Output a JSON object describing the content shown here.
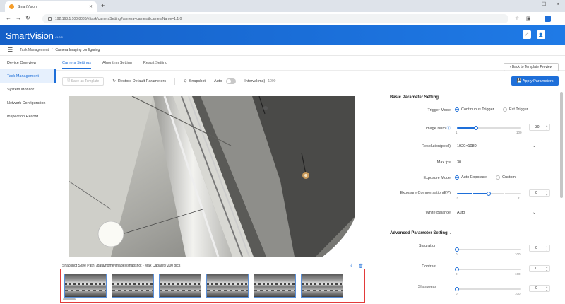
{
  "browser": {
    "tab_title": "SmartVision",
    "url": "192.168.1.100:8080/#/task/cameraSetting?camera=camera&cameraName=1.1.0",
    "new_tab": "+"
  },
  "app": {
    "brand": "SmartVision",
    "version": "v1.0.0",
    "header_icons": [
      "expand-icon",
      "user-icon"
    ]
  },
  "breadcrumb": [
    "Task Management",
    "Camera Imaging configuring"
  ],
  "sidebar": {
    "items": [
      {
        "label": "Device Overview",
        "active": false
      },
      {
        "label": "Task Management",
        "active": true
      },
      {
        "label": "System Monitor",
        "active": false
      },
      {
        "label": "Network Configuration",
        "active": false
      },
      {
        "label": "Inspection Record",
        "active": false
      }
    ]
  },
  "tabs": [
    {
      "label": "Camera Settings",
      "active": true
    },
    {
      "label": "Algorithm Setting",
      "active": false
    },
    {
      "label": "Result Setting",
      "active": false
    }
  ],
  "actions": {
    "back": "Back to Template Preview",
    "apply": "Apply Parameters"
  },
  "toolbar": {
    "save_template": "Save as Template",
    "restore": "Restore Default Parameters",
    "snapshot": "Snapshot",
    "auto": "Auto",
    "interval_label": "Interval(ms)",
    "interval_value": "1000"
  },
  "viewer": {
    "save_path": "Snapshot Save Path: /data/home/images/snapshot - Max Capacity 200 pics"
  },
  "basic": {
    "title": "Basic Parameter Setting",
    "trigger_mode_label": "Trigger Mode",
    "trigger_options": [
      "Continuous Trigger",
      "Ext Trigger"
    ],
    "trigger_selected": 0,
    "image_num_label": "Image Num",
    "image_num_value": "30",
    "image_num_fraction": 0.3,
    "image_num_min": "1",
    "image_num_max": "100",
    "resolution_label": "Resolution(pixel)",
    "resolution_value": "1920×1080",
    "max_fps_label": "Max fps",
    "max_fps_value": "30",
    "exposure_mode_label": "Exposure Mode",
    "exposure_options": [
      "Auto Exposure",
      "Custom"
    ],
    "exposure_selected": 0,
    "exposure_comp_label": "Exposure Compensation(EV)",
    "exposure_comp_value": "0",
    "exposure_comp_fraction": 0.5,
    "exposure_comp_min": "-2",
    "exposure_comp_max": "2",
    "wb_label": "White Balance",
    "wb_value": "Auto"
  },
  "advanced": {
    "title": "Advanced Parameter Setting",
    "sliders": [
      {
        "label": "Saturation",
        "value": "0",
        "min": "0",
        "max": "100",
        "fraction": 0
      },
      {
        "label": "Contrast",
        "value": "0",
        "min": "0",
        "max": "100",
        "fraction": 0
      },
      {
        "label": "Sharpness",
        "value": "0",
        "min": "0",
        "max": "100",
        "fraction": 0
      }
    ]
  },
  "colors": {
    "accent": "#1e6fd9",
    "header_start": "#1560c8",
    "header_end": "#1f7ae6",
    "highlight_border": "#e23a3a"
  }
}
